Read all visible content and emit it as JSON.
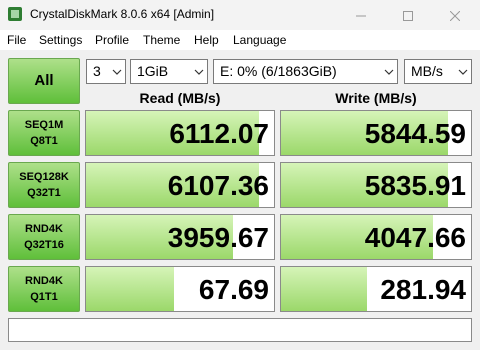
{
  "window": {
    "title": "CrystalDiskMark 8.0.6 x64 [Admin]"
  },
  "menu": [
    "File",
    "Settings",
    "Profile",
    "Theme",
    "Help",
    "Language"
  ],
  "controls": {
    "all_label": "All",
    "count": "3",
    "size": "1GiB",
    "drive": "E: 0% (6/1863GiB)",
    "unit": "MB/s"
  },
  "headers": {
    "read": "Read (MB/s)",
    "write": "Write (MB/s)"
  },
  "rows": [
    {
      "line1": "SEQ1M",
      "line2": "Q8T1",
      "read": "6112.07",
      "write": "5844.59",
      "read_fill": 0.92,
      "write_fill": 0.88
    },
    {
      "line1": "SEQ128K",
      "line2": "Q32T1",
      "read": "6107.36",
      "write": "5835.91",
      "read_fill": 0.92,
      "write_fill": 0.88
    },
    {
      "line1": "RND4K",
      "line2": "Q32T16",
      "read": "3959.67",
      "write": "4047.66",
      "read_fill": 0.78,
      "write_fill": 0.8
    },
    {
      "line1": "RND4K",
      "line2": "Q1T1",
      "read": "67.69",
      "write": "281.94",
      "read_fill": 0.47,
      "write_fill": 0.45
    }
  ],
  "comment": "",
  "colors": {
    "accent_green": "#5fbf3a",
    "fill_green": "#9bd86a"
  }
}
